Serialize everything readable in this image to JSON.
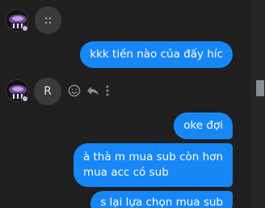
{
  "messages": [
    {
      "side": "in",
      "text": "::"
    },
    {
      "side": "out",
      "text": "kkk tiền nào của đấy híc"
    },
    {
      "side": "in",
      "text": "R"
    },
    {
      "side": "out",
      "text": "oke đợi"
    },
    {
      "side": "out",
      "line1": "à thà m mua sub còn hơn",
      "line2": "mua acc có sub"
    },
    {
      "side": "out",
      "text": "s lại lựa chọn mua sub"
    }
  ],
  "hover_actions": [
    "emoji-icon",
    "reply-icon",
    "more-icon"
  ],
  "colors": {
    "background": "#1f1f20",
    "outgoing_bubble": "#1787f7",
    "incoming_bubble": "#3a3b3c"
  }
}
